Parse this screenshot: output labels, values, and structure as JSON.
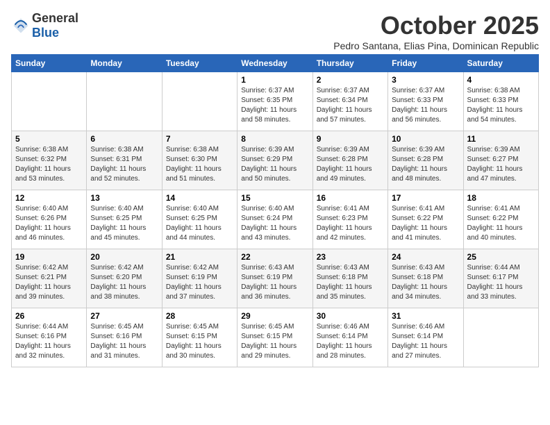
{
  "logo": {
    "text_general": "General",
    "text_blue": "Blue"
  },
  "header": {
    "month": "October 2025",
    "location": "Pedro Santana, Elias Pina, Dominican Republic"
  },
  "weekdays": [
    "Sunday",
    "Monday",
    "Tuesday",
    "Wednesday",
    "Thursday",
    "Friday",
    "Saturday"
  ],
  "weeks": [
    [
      {
        "day": "",
        "info": ""
      },
      {
        "day": "",
        "info": ""
      },
      {
        "day": "",
        "info": ""
      },
      {
        "day": "1",
        "info": "Sunrise: 6:37 AM\nSunset: 6:35 PM\nDaylight: 11 hours\nand 58 minutes."
      },
      {
        "day": "2",
        "info": "Sunrise: 6:37 AM\nSunset: 6:34 PM\nDaylight: 11 hours\nand 57 minutes."
      },
      {
        "day": "3",
        "info": "Sunrise: 6:37 AM\nSunset: 6:33 PM\nDaylight: 11 hours\nand 56 minutes."
      },
      {
        "day": "4",
        "info": "Sunrise: 6:38 AM\nSunset: 6:33 PM\nDaylight: 11 hours\nand 54 minutes."
      }
    ],
    [
      {
        "day": "5",
        "info": "Sunrise: 6:38 AM\nSunset: 6:32 PM\nDaylight: 11 hours\nand 53 minutes."
      },
      {
        "day": "6",
        "info": "Sunrise: 6:38 AM\nSunset: 6:31 PM\nDaylight: 11 hours\nand 52 minutes."
      },
      {
        "day": "7",
        "info": "Sunrise: 6:38 AM\nSunset: 6:30 PM\nDaylight: 11 hours\nand 51 minutes."
      },
      {
        "day": "8",
        "info": "Sunrise: 6:39 AM\nSunset: 6:29 PM\nDaylight: 11 hours\nand 50 minutes."
      },
      {
        "day": "9",
        "info": "Sunrise: 6:39 AM\nSunset: 6:28 PM\nDaylight: 11 hours\nand 49 minutes."
      },
      {
        "day": "10",
        "info": "Sunrise: 6:39 AM\nSunset: 6:28 PM\nDaylight: 11 hours\nand 48 minutes."
      },
      {
        "day": "11",
        "info": "Sunrise: 6:39 AM\nSunset: 6:27 PM\nDaylight: 11 hours\nand 47 minutes."
      }
    ],
    [
      {
        "day": "12",
        "info": "Sunrise: 6:40 AM\nSunset: 6:26 PM\nDaylight: 11 hours\nand 46 minutes."
      },
      {
        "day": "13",
        "info": "Sunrise: 6:40 AM\nSunset: 6:25 PM\nDaylight: 11 hours\nand 45 minutes."
      },
      {
        "day": "14",
        "info": "Sunrise: 6:40 AM\nSunset: 6:25 PM\nDaylight: 11 hours\nand 44 minutes."
      },
      {
        "day": "15",
        "info": "Sunrise: 6:40 AM\nSunset: 6:24 PM\nDaylight: 11 hours\nand 43 minutes."
      },
      {
        "day": "16",
        "info": "Sunrise: 6:41 AM\nSunset: 6:23 PM\nDaylight: 11 hours\nand 42 minutes."
      },
      {
        "day": "17",
        "info": "Sunrise: 6:41 AM\nSunset: 6:22 PM\nDaylight: 11 hours\nand 41 minutes."
      },
      {
        "day": "18",
        "info": "Sunrise: 6:41 AM\nSunset: 6:22 PM\nDaylight: 11 hours\nand 40 minutes."
      }
    ],
    [
      {
        "day": "19",
        "info": "Sunrise: 6:42 AM\nSunset: 6:21 PM\nDaylight: 11 hours\nand 39 minutes."
      },
      {
        "day": "20",
        "info": "Sunrise: 6:42 AM\nSunset: 6:20 PM\nDaylight: 11 hours\nand 38 minutes."
      },
      {
        "day": "21",
        "info": "Sunrise: 6:42 AM\nSunset: 6:19 PM\nDaylight: 11 hours\nand 37 minutes."
      },
      {
        "day": "22",
        "info": "Sunrise: 6:43 AM\nSunset: 6:19 PM\nDaylight: 11 hours\nand 36 minutes."
      },
      {
        "day": "23",
        "info": "Sunrise: 6:43 AM\nSunset: 6:18 PM\nDaylight: 11 hours\nand 35 minutes."
      },
      {
        "day": "24",
        "info": "Sunrise: 6:43 AM\nSunset: 6:18 PM\nDaylight: 11 hours\nand 34 minutes."
      },
      {
        "day": "25",
        "info": "Sunrise: 6:44 AM\nSunset: 6:17 PM\nDaylight: 11 hours\nand 33 minutes."
      }
    ],
    [
      {
        "day": "26",
        "info": "Sunrise: 6:44 AM\nSunset: 6:16 PM\nDaylight: 11 hours\nand 32 minutes."
      },
      {
        "day": "27",
        "info": "Sunrise: 6:45 AM\nSunset: 6:16 PM\nDaylight: 11 hours\nand 31 minutes."
      },
      {
        "day": "28",
        "info": "Sunrise: 6:45 AM\nSunset: 6:15 PM\nDaylight: 11 hours\nand 30 minutes."
      },
      {
        "day": "29",
        "info": "Sunrise: 6:45 AM\nSunset: 6:15 PM\nDaylight: 11 hours\nand 29 minutes."
      },
      {
        "day": "30",
        "info": "Sunrise: 6:46 AM\nSunset: 6:14 PM\nDaylight: 11 hours\nand 28 minutes."
      },
      {
        "day": "31",
        "info": "Sunrise: 6:46 AM\nSunset: 6:14 PM\nDaylight: 11 hours\nand 27 minutes."
      },
      {
        "day": "",
        "info": ""
      }
    ]
  ]
}
